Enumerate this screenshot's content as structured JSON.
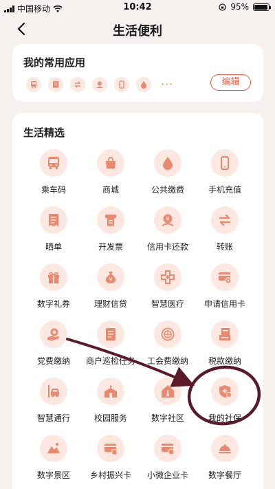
{
  "status_bar": {
    "carrier": "中国移动",
    "time": "10:42",
    "battery": "95%",
    "battery_level": 0.95
  },
  "header": {
    "title": "生活便利"
  },
  "favorites": {
    "title": "我的常用应用",
    "edit_label": "编辑",
    "icons": [
      "bus-icon",
      "receipt-icon",
      "transfer-icon",
      "wealth-icon",
      "phone-icon",
      "drop-icon",
      "more-icon"
    ],
    "more": "···"
  },
  "life": {
    "title": "生活精选",
    "items": [
      {
        "label": "乘车码",
        "icon": "bus-icon"
      },
      {
        "label": "商城",
        "icon": "shopping-bag-icon"
      },
      {
        "label": "公共缴费",
        "icon": "drop-icon"
      },
      {
        "label": "手机充值",
        "icon": "phone-icon"
      },
      {
        "label": "晒单",
        "icon": "receipt-icon"
      },
      {
        "label": "开发票",
        "icon": "invoice-icon"
      },
      {
        "label": "信用卡还款",
        "icon": "credit-repay-icon"
      },
      {
        "label": "转账",
        "icon": "transfer-icon"
      },
      {
        "label": "数字礼券",
        "icon": "gift-icon"
      },
      {
        "label": "理财信贷",
        "icon": "money-bag-icon"
      },
      {
        "label": "智慧医疗",
        "icon": "medical-cross-icon"
      },
      {
        "label": "申请信用卡",
        "icon": "credit-card-icon"
      },
      {
        "label": "党费缴纳",
        "icon": "party-fee-icon"
      },
      {
        "label": "商户巡检任务",
        "icon": "checklist-icon"
      },
      {
        "label": "工会费缴纳",
        "icon": "union-badge-icon"
      },
      {
        "label": "税款缴纳",
        "icon": "tax-icon"
      },
      {
        "label": "智慧通行",
        "icon": "car-icon"
      },
      {
        "label": "校园服务",
        "icon": "school-icon"
      },
      {
        "label": "数字社区",
        "icon": "home-thermo-icon"
      },
      {
        "label": "我的社保",
        "icon": "shield-plus-icon"
      },
      {
        "label": "数字景区",
        "icon": "mountain-icon"
      },
      {
        "label": "乡村振兴卡",
        "icon": "village-card-icon"
      },
      {
        "label": "小微企业卡",
        "icon": "business-card-icon"
      },
      {
        "label": "数字餐厅",
        "icon": "dining-cloche-icon"
      }
    ]
  },
  "colors": {
    "accent": "#e2674c",
    "icon_bg": "#fde8e1",
    "page_bg": "#f6f1ee",
    "annotation": "#5b1a2a"
  }
}
